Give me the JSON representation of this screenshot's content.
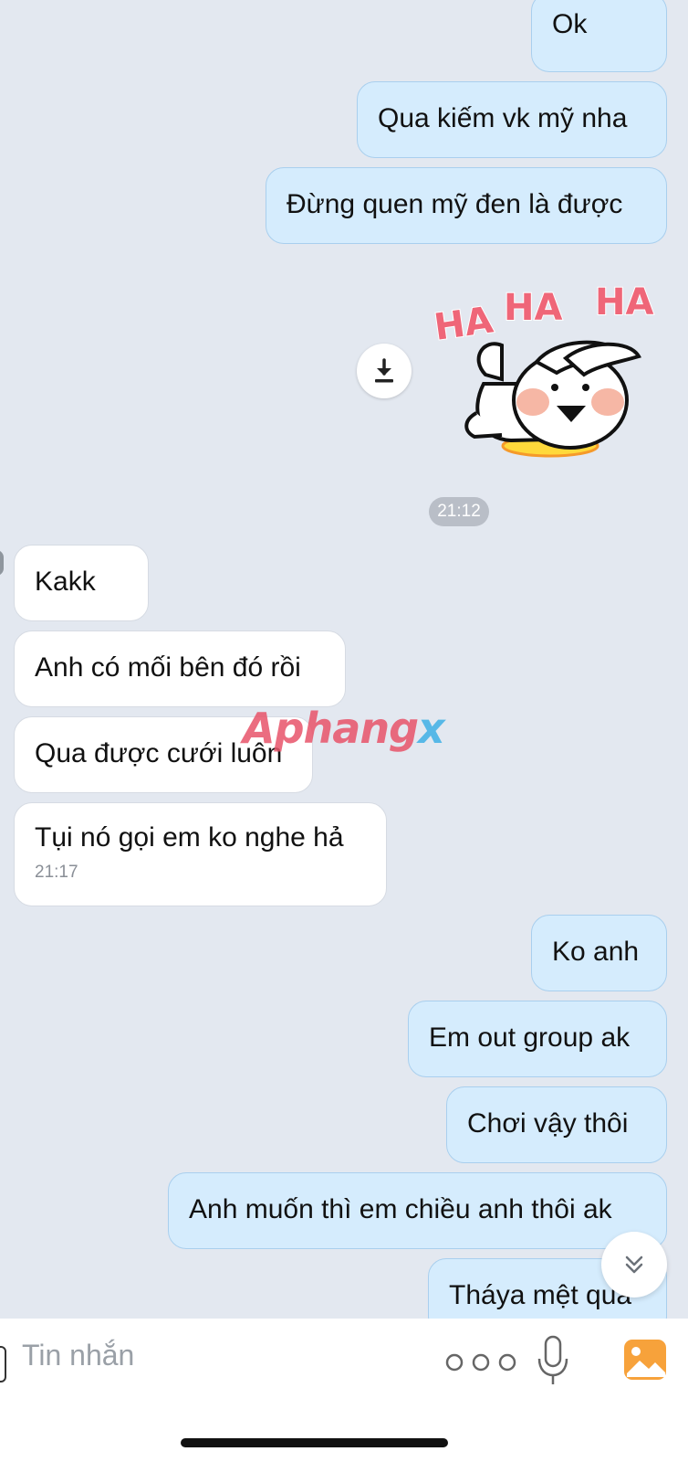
{
  "messages_top": [
    {
      "text": "Ok"
    },
    {
      "text": "Qua kiếm vk mỹ nha"
    },
    {
      "text": "Đừng quen mỹ đen là được"
    }
  ],
  "sticker": {
    "text1": "HA",
    "text2": "HA",
    "text3": "HA"
  },
  "time_divider": "21:12",
  "messages_incoming": [
    {
      "text": "Kakk"
    },
    {
      "text": "Anh có mối bên đó rồi"
    },
    {
      "text": "Qua được cưới luôn"
    },
    {
      "text": "Tụi nó gọi em ko nghe hả",
      "time": "21:17"
    }
  ],
  "messages_bottom": [
    {
      "text": "Ko anh"
    },
    {
      "text": "Em out group ak"
    },
    {
      "text": "Chơi vậy thôi"
    },
    {
      "text": "Anh muốn thì em chiều anh thôi ak"
    },
    {
      "text": "Tháya mệt qua"
    }
  ],
  "watermark": {
    "main": "Aphang",
    "suffix": "x"
  },
  "composer": {
    "placeholder": "Tin nhắn"
  },
  "colors": {
    "background": "#e3e8f0",
    "outgoing_bubble": "#d5ecfd",
    "incoming_bubble": "#ffffff",
    "gallery_icon": "#f7a23b"
  }
}
